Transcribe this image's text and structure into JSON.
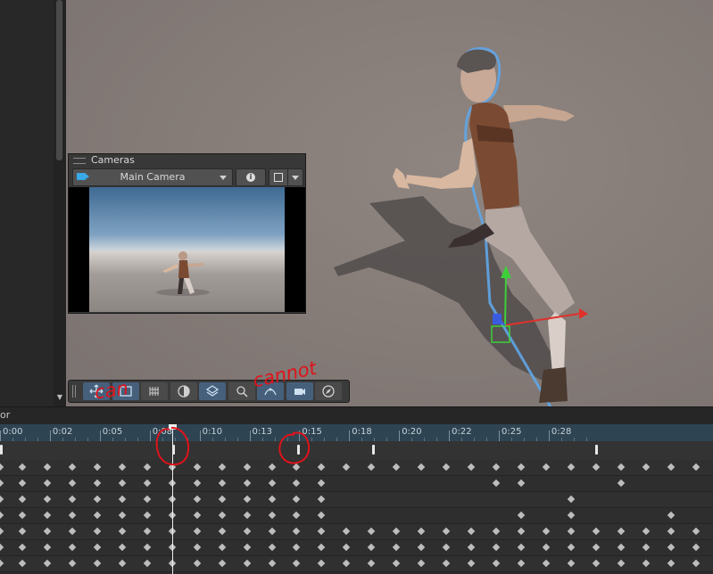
{
  "scene": {
    "cameras_panel": {
      "title": "Cameras",
      "selected_camera": "Main Camera",
      "camera_icon": "camera-icon",
      "info_icon": "info-icon",
      "frame_icon": "frame-icon",
      "info_glyph": "i"
    },
    "toolbar": {
      "tools": [
        {
          "name": "move-tool",
          "icon": "move-arrows-icon",
          "active": true
        },
        {
          "name": "rect-tool",
          "icon": "rect-transform-icon",
          "active": true
        },
        {
          "name": "grid-tool",
          "icon": "grid-snap-icon",
          "active": false
        },
        {
          "name": "orbit-tool",
          "icon": "orbit-icon",
          "active": false
        },
        {
          "name": "layers-tool",
          "icon": "layers-icon",
          "active": true
        },
        {
          "name": "zoom-tool",
          "icon": "magnifier-icon",
          "active": false
        },
        {
          "name": "path-tool",
          "icon": "path-icon",
          "active": true
        },
        {
          "name": "camera-tool",
          "icon": "camera-view-icon",
          "active": true
        },
        {
          "name": "compass-tool",
          "icon": "compass-icon",
          "active": false
        }
      ]
    },
    "annotations": {
      "can": "can",
      "cannot": "cannot"
    }
  },
  "timeline": {
    "header_label": "or",
    "ticks": [
      "0:00",
      "0:02",
      "0:05",
      "0:08",
      "0:10",
      "0:13",
      "0:15",
      "0:18",
      "0:20",
      "0:22",
      "0:25",
      "0:28"
    ],
    "event_count": 5,
    "keyframe_rows": 7
  },
  "colors": {
    "accent_active": "#46607c",
    "ruler": "#2e4452",
    "annotation": "#e0121a",
    "gizmo_x": "#e0302a",
    "gizmo_y": "#3ed03a",
    "gizmo_z": "#3a5be0"
  }
}
